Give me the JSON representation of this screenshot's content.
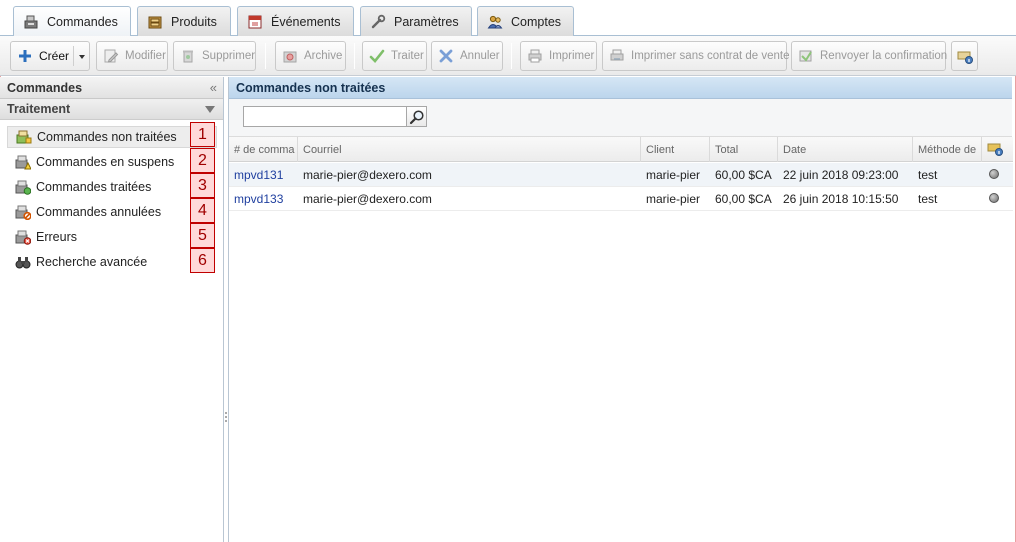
{
  "tabs": [
    {
      "label": "Commandes",
      "icon": "cash-register-icon",
      "active": true
    },
    {
      "label": "Produits",
      "icon": "product-box-icon",
      "active": false
    },
    {
      "label": "Événements",
      "icon": "calendar-icon",
      "active": false
    },
    {
      "label": "Paramètres",
      "icon": "wrench-icon",
      "active": false
    },
    {
      "label": "Comptes",
      "icon": "users-icon",
      "active": false
    }
  ],
  "toolbar": {
    "create": "Créer",
    "modify": "Modifier",
    "delete": "Supprimer",
    "archive": "Archive",
    "process": "Traiter",
    "cancel": "Annuler",
    "print": "Imprimer",
    "print_no_contract": "Imprimer sans contrat de vente",
    "resend": "Renvoyer la confirmation"
  },
  "left_panel": {
    "title": "Commandes",
    "collapse_glyph": "«",
    "section": "Traitement",
    "items": [
      {
        "label": "Commandes non traitées",
        "icon": "unprocessed-orders-icon",
        "badge": "1",
        "selected": true
      },
      {
        "label": "Commandes en suspens",
        "icon": "pending-orders-icon",
        "badge": "2",
        "selected": false
      },
      {
        "label": "Commandes traitées",
        "icon": "processed-orders-icon",
        "badge": "3",
        "selected": false
      },
      {
        "label": "Commandes annulées",
        "icon": "cancelled-orders-icon",
        "badge": "4",
        "selected": false
      },
      {
        "label": "Erreurs",
        "icon": "error-icon",
        "badge": "5",
        "selected": false
      },
      {
        "label": "Recherche avancée",
        "icon": "binoculars-icon",
        "badge": "6",
        "selected": false
      }
    ]
  },
  "main": {
    "title": "Commandes non traitées",
    "search": {
      "value": "",
      "placeholder": ""
    },
    "columns": [
      "# de comma",
      "Courriel",
      "Client",
      "Total",
      "Date",
      "Méthode de"
    ],
    "rows": [
      {
        "order": "mpvd131",
        "email": "marie-pier@dexero.com",
        "client": "marie-pier",
        "total": "60,00 $CA",
        "date": "22 juin 2018 09:23:00",
        "method": "test"
      },
      {
        "order": "mpvd133",
        "email": "marie-pier@dexero.com",
        "client": "marie-pier",
        "total": "60,00 $CA",
        "date": "26 juin 2018 10:15:50",
        "method": "test"
      }
    ]
  },
  "colors": {
    "badge_border": "#c00000",
    "badge_fill": "#ffd9d9",
    "header_blue": "#bcd5ec",
    "link_blue": "#1f3f9f"
  }
}
